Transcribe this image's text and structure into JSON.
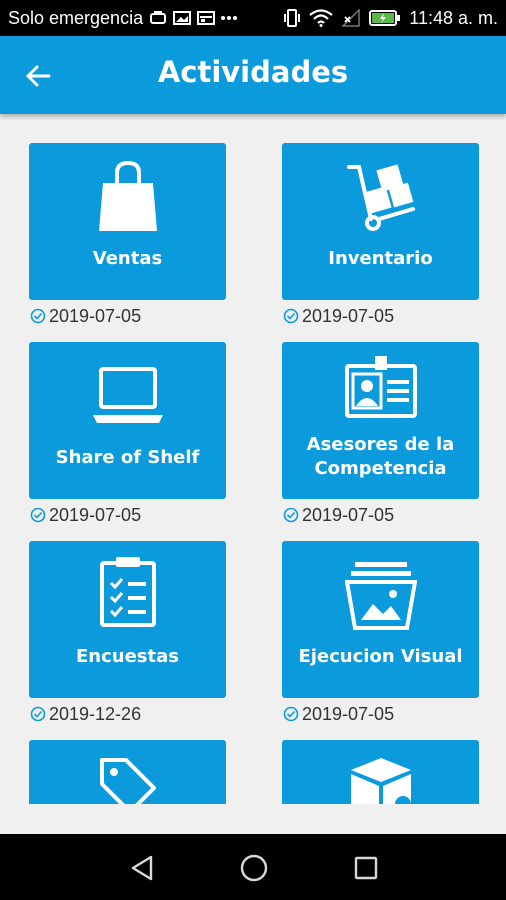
{
  "status_bar": {
    "carrier": "Solo emergencia",
    "time": "11:48 a. m."
  },
  "appbar": {
    "title": "Actividades"
  },
  "activities": [
    {
      "label": "Ventas",
      "date": "2019-07-05",
      "icon": "shopping-bag-icon"
    },
    {
      "label": "Inventario",
      "date": "2019-07-05",
      "icon": "hand-truck-icon"
    },
    {
      "label": "Share of Shelf",
      "date": "2019-07-05",
      "icon": "laptop-icon"
    },
    {
      "label": "Asesores de la Competencia",
      "date": "2019-07-05",
      "icon": "id-badge-icon"
    },
    {
      "label": "Encuestas",
      "date": "2019-12-26",
      "icon": "clipboard-checklist-icon"
    },
    {
      "label": "Ejecucion Visual",
      "date": "2019-07-05",
      "icon": "photo-stack-icon"
    },
    {
      "label": "",
      "date": "",
      "icon": "price-tag-icon"
    },
    {
      "label": "",
      "date": "",
      "icon": "package-box-icon"
    }
  ],
  "colors": {
    "primary": "#0b9bdc",
    "background": "#f0f0f0",
    "status_bar": "#000000"
  }
}
